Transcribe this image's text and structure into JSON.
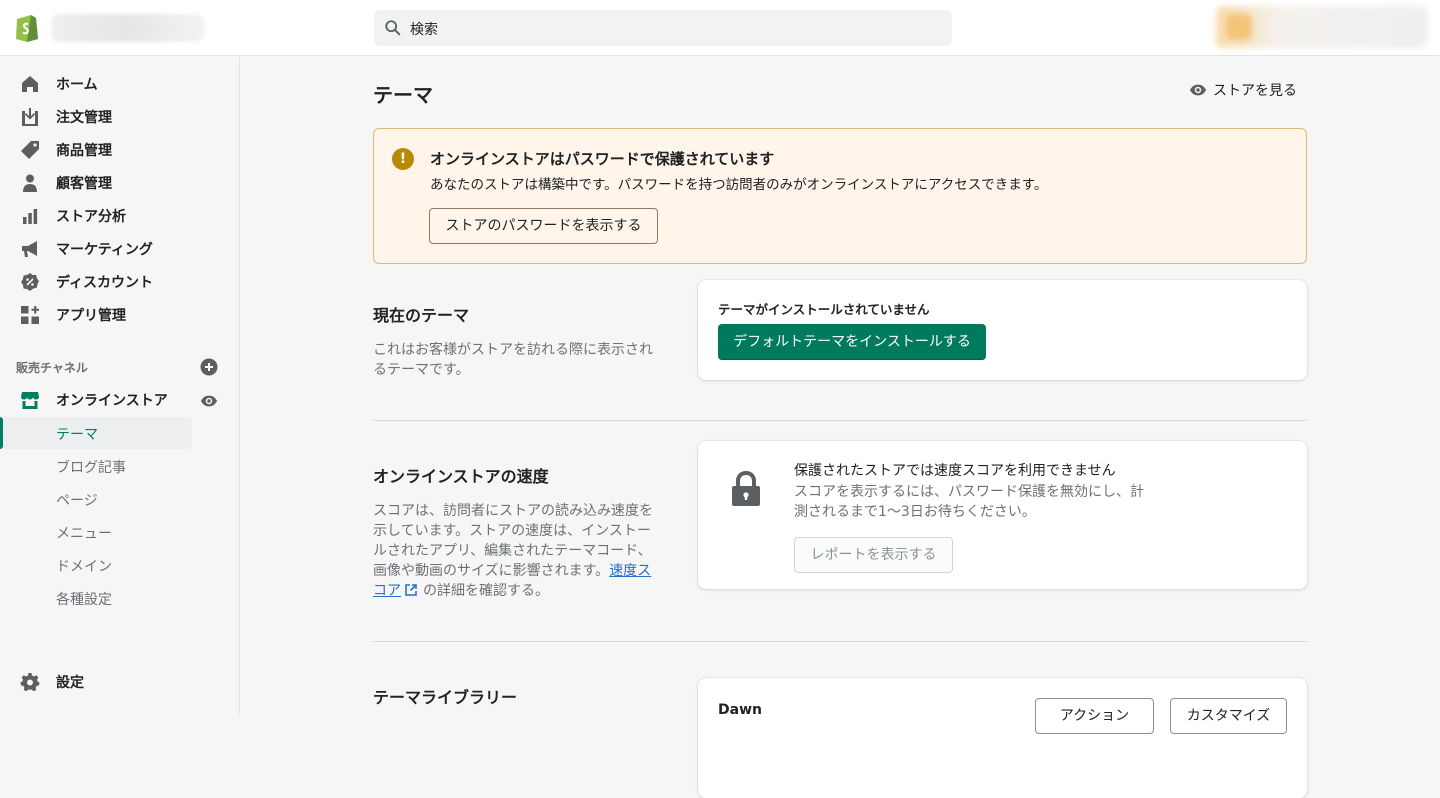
{
  "header": {
    "search_placeholder": "検索"
  },
  "sidebar": {
    "items": [
      {
        "label": "ホーム",
        "icon": "home-icon"
      },
      {
        "label": "注文管理",
        "icon": "orders-icon"
      },
      {
        "label": "商品管理",
        "icon": "tag-icon"
      },
      {
        "label": "顧客管理",
        "icon": "customer-icon"
      },
      {
        "label": "ストア分析",
        "icon": "analytics-icon"
      },
      {
        "label": "マーケティング",
        "icon": "megaphone-icon"
      },
      {
        "label": "ディスカウント",
        "icon": "discount-icon"
      },
      {
        "label": "アプリ管理",
        "icon": "apps-icon"
      }
    ],
    "sales_channels_label": "販売チャネル",
    "online_store": "オンラインストア",
    "sub_items": [
      "テーマ",
      "ブログ記事",
      "ページ",
      "メニュー",
      "ドメイン",
      "各種設定"
    ],
    "active_sub_item": "テーマ",
    "settings": "設定"
  },
  "main": {
    "title": "テーマ",
    "view_store": "ストアを見る",
    "banner": {
      "title": "オンラインストアはパスワードで保護されています",
      "description": "あなたのストアは構築中です。パスワードを持つ訪問者のみがオンラインストアにアクセスできます。",
      "button": "ストアのパスワードを表示する"
    },
    "current_theme": {
      "title": "現在のテーマ",
      "description": "これはお客様がストアを訪れる際に表示されるテーマです。",
      "card_label": "テーマがインストールされていません",
      "button": "デフォルトテーマをインストールする"
    },
    "speed": {
      "title": "オンラインストアの速度",
      "description_before": "スコアは、訪問者にストアの読み込み速度を示しています。ストアの速度は、インストールされたアプリ、編集されたテーマコード、画像や動画のサイズに影響されます。",
      "link": "速度スコア",
      "description_after": "の詳細を確認する。",
      "card_title": "保護されたストアでは速度スコアを利用できません",
      "card_desc": "スコアを表示するには、パスワード保護を無効にし、計測されるまで1〜3日お待ちください。",
      "button": "レポートを表示する"
    },
    "library": {
      "title": "テーマライブラリー",
      "theme_name": "Dawn",
      "actions_button": "アクション",
      "customize_button": "カスタマイズ"
    }
  },
  "colors": {
    "accent": "#008060",
    "banner_bg": "#fff5ea",
    "warning": "#b98900"
  }
}
